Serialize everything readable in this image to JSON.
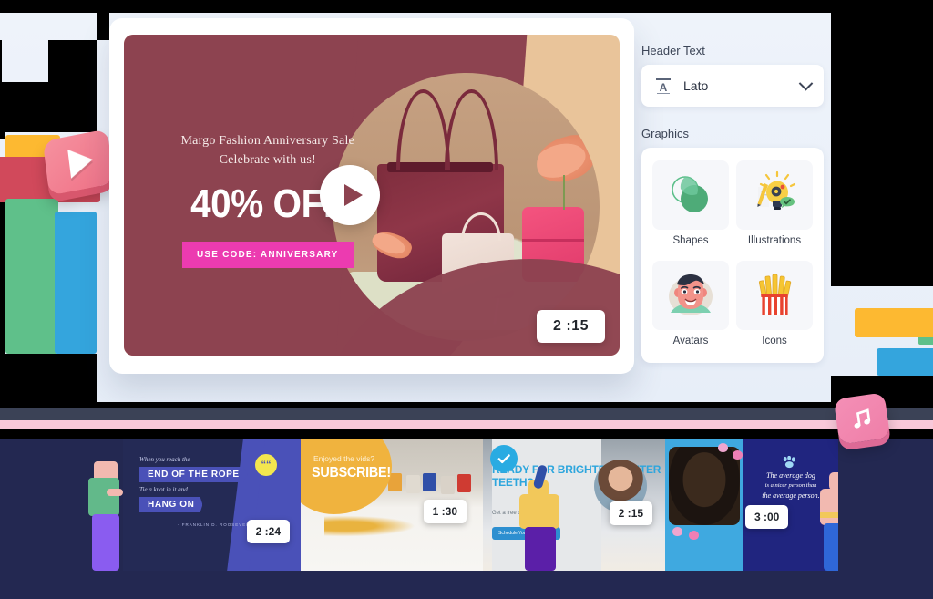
{
  "theme": {
    "bg": "#eef3fa",
    "accent_pink": "#ec3bb0",
    "card_maroon": "#8d4350",
    "card_sand": "#e9c49a",
    "strip_navy": "#232851"
  },
  "preview": {
    "subtitle_line1": "Margo Fashion Anniversary Sale",
    "subtitle_line2": "Celebrate with us!",
    "headline": "40% OFF",
    "promo_code": "USE CODE: ANNIVERSARY",
    "duration": "2 :15",
    "play_icon": "play-icon"
  },
  "sidebar": {
    "header_text_label": "Header Text",
    "font_select": {
      "icon": "font-style-icon",
      "value": "Lato",
      "chevron": "chevron-down-icon"
    },
    "graphics_label": "Graphics",
    "graphics": [
      {
        "label": "Shapes",
        "icon": "overlapping-circles-icon"
      },
      {
        "label": "Illustrations",
        "icon": "lightbulb-idea-icon"
      },
      {
        "label": "Avatars",
        "icon": "avatar-face-icon"
      },
      {
        "label": "Icons",
        "icon": "french-fries-icon"
      }
    ]
  },
  "filmstrip": {
    "items": [
      {
        "id": "quote-rope",
        "duration": "2 :24",
        "script_line1": "When you reach the",
        "banner_line1": "END OF THE ROPE",
        "script_line2": "Tie a knot in it and",
        "banner_line2": "HANG ON",
        "attribution": "- FRANKLIN D. ROOSEVELT",
        "badge_icon": "quote-marks-icon"
      },
      {
        "id": "subscribe",
        "duration": "1 :30",
        "small_text": "Enjoyed the vids?",
        "big_text": "SUBSCRIBE!"
      },
      {
        "id": "teeth-whitening",
        "duration": "2 :15",
        "headline": "READY FOR BRIGHTER, WHITER TEETH?",
        "subtext": "Get a free consultation",
        "button_label": "Schedule Your Appointment",
        "badge_icon": "check-circle-icon"
      },
      {
        "id": "average-dog",
        "duration": "3 :00",
        "line1": "The average dog",
        "line2": "is a nicer person than",
        "line3": "the average person.",
        "badge_icon": "paw-print-icon"
      }
    ]
  },
  "decorations": {
    "left_play_icon": "play-button-3d-icon",
    "right_music_icon": "music-note-3d-icon",
    "left_blocks": [
      "#fdb931",
      "#d1495b",
      "#5fc08a",
      "#34a5dd"
    ],
    "right_blocks": [
      "#fdb931",
      "#5fc08a",
      "#34a5dd"
    ]
  }
}
